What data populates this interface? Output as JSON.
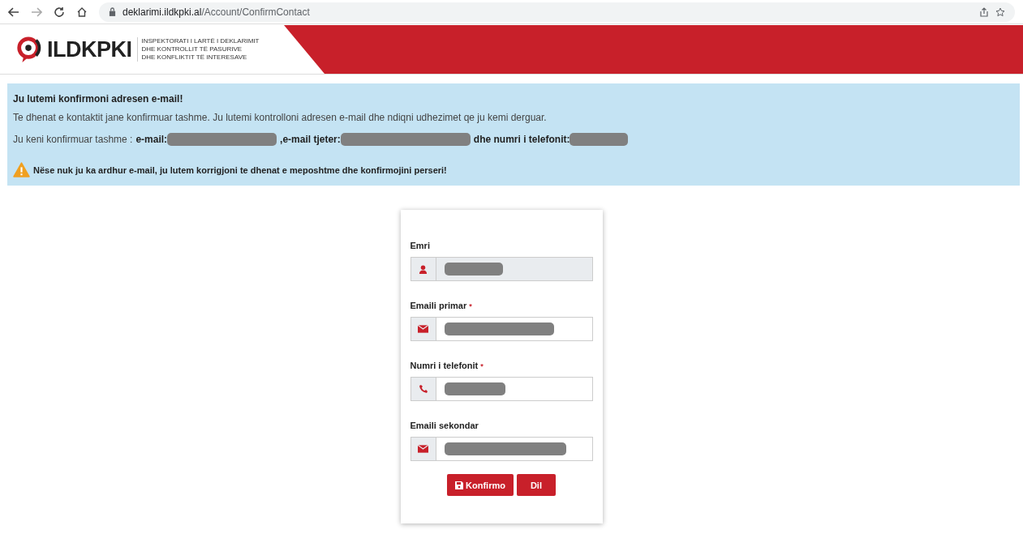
{
  "browser": {
    "url_host": "deklarimi.ildkpki.al",
    "url_path": "/Account/ConfirmContact"
  },
  "header": {
    "logo_text": "ILDKPKI",
    "org_lines": [
      "INSPEKTORATI I LARTË I DEKLARIMIT",
      "DHE KONTROLLIT TË PASURIVE",
      "DHE KONFLIKTIT TË INTERESAVE"
    ]
  },
  "alert": {
    "title": "Ju lutemi konfirmoni adresen e-mail!",
    "message": "Te dhenat e kontaktit jane konfirmuar tashme. Ju lutemi kontrolloni adresen e-mail dhe ndiqni udhezimet qe ju kemi derguar.",
    "confirmed_prefix": "Ju keni konfirmuar tashme :",
    "confirmed_items": [
      {
        "label": "e-mail:"
      },
      {
        "label": ",e-mail tjeter:"
      },
      {
        "label": "dhe numri i telefonit:"
      }
    ],
    "warning": "Nëse nuk ju ka ardhur e-mail, ju lutem korrigjoni te dhenat e meposhtme dhe konfirmojini perseri!"
  },
  "form": {
    "required_mark": "*",
    "fields": [
      {
        "label": "Emri",
        "required": false,
        "disabled": true,
        "kind": "user"
      },
      {
        "label": "Emaili primar",
        "required": true,
        "disabled": false,
        "kind": "mail"
      },
      {
        "label": "Numri i telefonit",
        "required": true,
        "disabled": false,
        "kind": "phone"
      },
      {
        "label": "Emaili sekondar",
        "required": false,
        "disabled": false,
        "kind": "mail"
      }
    ],
    "buttons": [
      {
        "label": "Konfirmo",
        "kind": "save"
      },
      {
        "label": "Dil",
        "kind": "plain"
      }
    ]
  }
}
